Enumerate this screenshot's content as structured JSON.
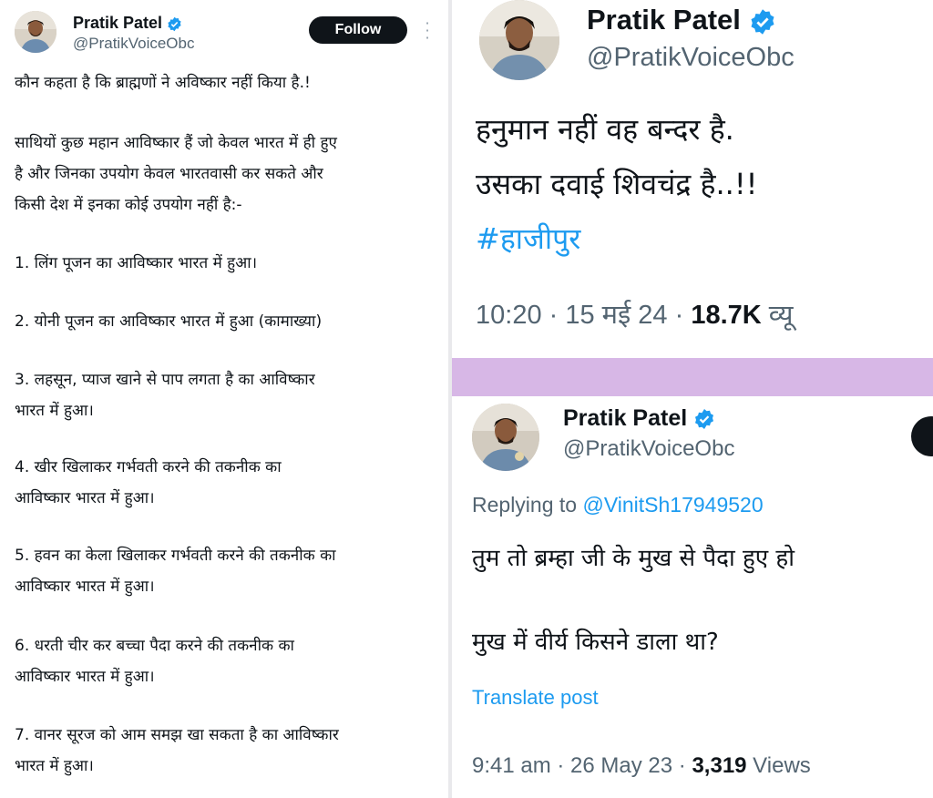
{
  "left_tweet": {
    "author_name": "Pratik Patel",
    "handle": "@PratikVoiceObc",
    "follow_label": "Follow",
    "lines": [
      "कौन कहता है कि ब्राह्मणों ने अविष्कार नहीं किया है.!",
      "साथियों कुछ महान आविष्कार हैं जो केवल भारत में ही हुए",
      "है और जिनका उपयोग केवल भारतवासी कर सकते और",
      "किसी देश में इनका कोई उपयोग नहीं है:-",
      "1. लिंग पूजन का आविष्कार भारत में हुआ।",
      "2. योनी पूजन का आविष्कार भारत में हुआ (कामाख्या)",
      "3. लहसून, प्याज खाने से पाप लगता है का आविष्कार",
      "भारत में हुआ।",
      "4. खीर खिलाकर गर्भवती करने की तकनीक का",
      "आविष्कार भारत में हुआ।",
      "5. हवन का केला खिलाकर गर्भवती करने की तकनीक का",
      "आविष्कार भारत में हुआ।",
      "6. धरती चीर कर बच्चा पैदा करने की तकनीक का",
      "आविष्कार भारत में हुआ।",
      "7. वानर सूरज को आम समझ खा सकता है का आविष्कार",
      "भारत में हुआ।"
    ]
  },
  "right_top_tweet": {
    "author_name": "Pratik Patel",
    "handle": "@PratikVoiceObc",
    "lines": [
      "हनुमान नहीं वह बन्दर है.",
      "उसका दवाई शिवचंद्र है..!!"
    ],
    "hashtag": "#हाजीपुर",
    "time_date": "10:20 · 15 मई 24 · ",
    "views_count": "18.7K",
    "views_label": " व्यू"
  },
  "right_bottom_tweet": {
    "author_name": "Pratik Patel",
    "handle": "@PratikVoiceObc",
    "replying_prefix": "Replying to ",
    "replying_to": "@VinitSh17949520",
    "lines": [
      "तुम तो ब्रम्हा जी के मुख से पैदा हुए हो",
      "मुख में वीर्य किसने डाला था?"
    ],
    "translate_label": "Translate post",
    "time_date": "9:41 am · 26 May 23 · ",
    "views_count": "3,319",
    "views_label": " Views"
  },
  "colors": {
    "accent_blue": "#1d9bf0",
    "verified_blue": "#1d9bf0",
    "secondary_text": "#536471",
    "purple_band": "#d7b7e6"
  },
  "icons": [
    "verified-badge-icon",
    "more-options-icon"
  ]
}
